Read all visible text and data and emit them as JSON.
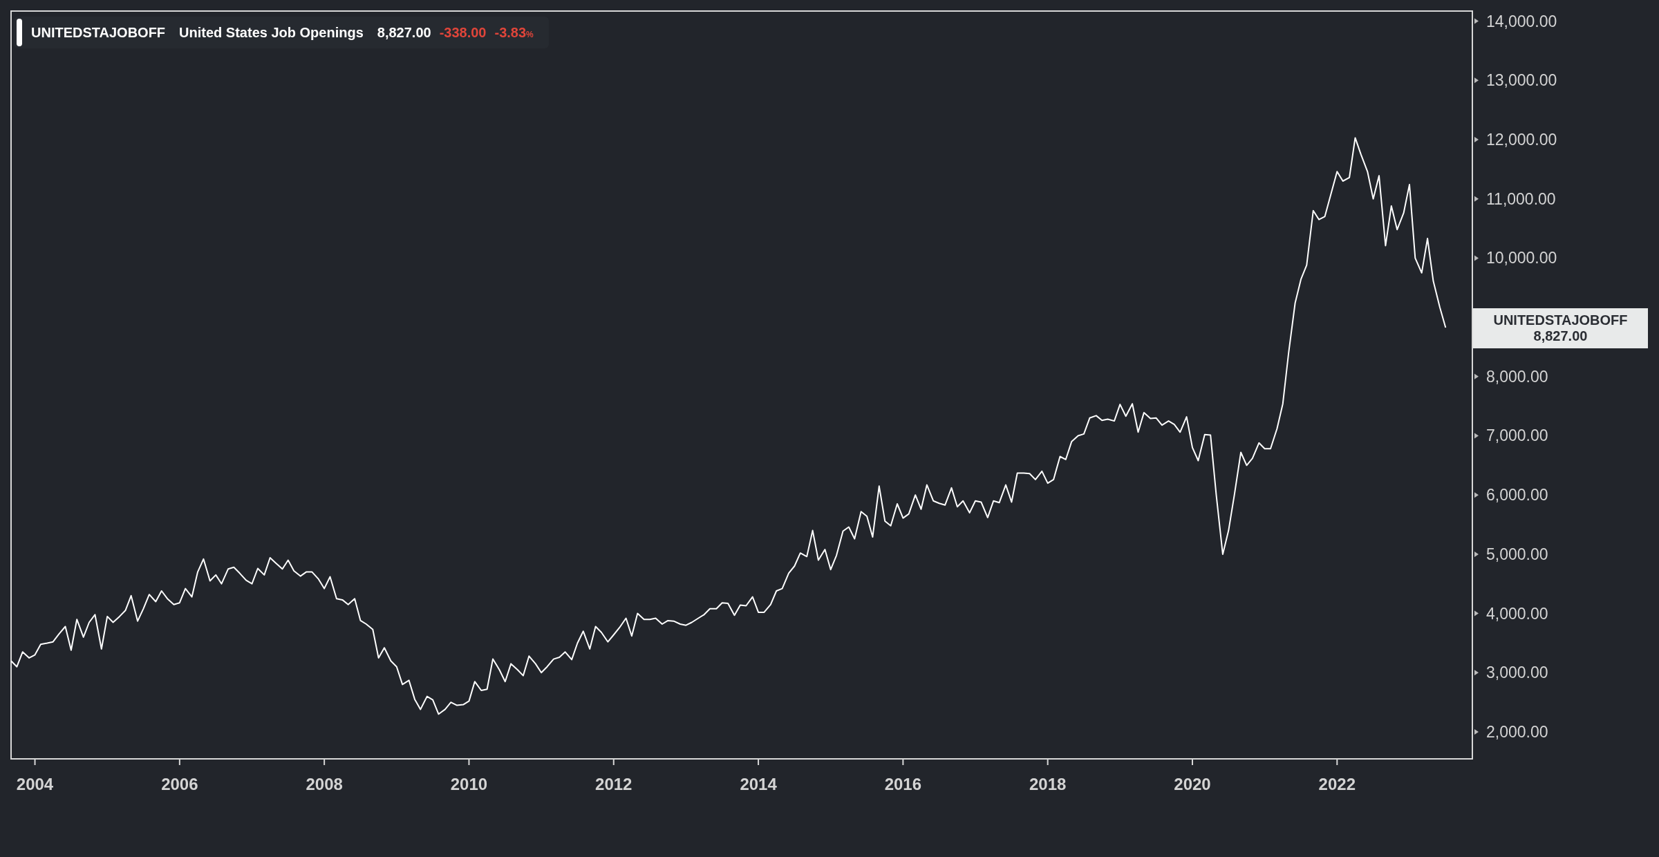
{
  "legend": {
    "symbol": "UNITEDSTAJOBOFF",
    "name": "United States Job Openings",
    "value": "8,827.00",
    "change": "-338.00",
    "change_percent": "-3.83",
    "percent_sign": "%"
  },
  "price_label": {
    "value": "8,827.00"
  },
  "chart_data": {
    "type": "line",
    "xlim": [
      2003.67,
      2023.87
    ],
    "ylim": [
      1545,
      14170
    ],
    "xticks": [
      {
        "value": 2004,
        "label": "2004"
      },
      {
        "value": 2006,
        "label": "2006"
      },
      {
        "value": 2008,
        "label": "2008"
      },
      {
        "value": 2010,
        "label": "2010"
      },
      {
        "value": 2012,
        "label": "2012"
      },
      {
        "value": 2014,
        "label": "2014"
      },
      {
        "value": 2016,
        "label": "2016"
      },
      {
        "value": 2018,
        "label": "2018"
      },
      {
        "value": 2020,
        "label": "2020"
      },
      {
        "value": 2022,
        "label": "2022"
      }
    ],
    "x": [
      2003.67,
      2003.75,
      2003.83,
      2003.92,
      2004,
      2004.08,
      2004.17,
      2004.25,
      2004.33,
      2004.42,
      2004.5,
      2004.58,
      2004.67,
      2004.75,
      2004.83,
      2004.92,
      2005,
      2005.08,
      2005.17,
      2005.25,
      2005.33,
      2005.42,
      2005.5,
      2005.58,
      2005.67,
      2005.75,
      2005.83,
      2005.92,
      2006,
      2006.08,
      2006.17,
      2006.25,
      2006.33,
      2006.42,
      2006.5,
      2006.58,
      2006.67,
      2006.75,
      2006.83,
      2006.92,
      2007,
      2007.08,
      2007.17,
      2007.25,
      2007.33,
      2007.42,
      2007.5,
      2007.58,
      2007.67,
      2007.75,
      2007.83,
      2007.92,
      2008,
      2008.08,
      2008.17,
      2008.25,
      2008.33,
      2008.42,
      2008.5,
      2008.58,
      2008.67,
      2008.75,
      2008.83,
      2008.92,
      2009,
      2009.08,
      2009.17,
      2009.25,
      2009.33,
      2009.42,
      2009.5,
      2009.58,
      2009.67,
      2009.75,
      2009.83,
      2009.92,
      2010,
      2010.08,
      2010.17,
      2010.25,
      2010.33,
      2010.42,
      2010.5,
      2010.58,
      2010.67,
      2010.75,
      2010.83,
      2010.92,
      2011,
      2011.08,
      2011.17,
      2011.25,
      2011.33,
      2011.42,
      2011.5,
      2011.58,
      2011.67,
      2011.75,
      2011.83,
      2011.92,
      2012,
      2012.08,
      2012.17,
      2012.25,
      2012.33,
      2012.42,
      2012.5,
      2012.58,
      2012.67,
      2012.75,
      2012.83,
      2012.92,
      2013,
      2013.08,
      2013.17,
      2013.25,
      2013.33,
      2013.42,
      2013.5,
      2013.58,
      2013.67,
      2013.75,
      2013.83,
      2013.92,
      2014,
      2014.08,
      2014.17,
      2014.25,
      2014.33,
      2014.42,
      2014.5,
      2014.58,
      2014.67,
      2014.75,
      2014.83,
      2014.92,
      2015,
      2015.08,
      2015.17,
      2015.25,
      2015.33,
      2015.42,
      2015.5,
      2015.58,
      2015.67,
      2015.75,
      2015.83,
      2015.92,
      2016,
      2016.08,
      2016.17,
      2016.25,
      2016.33,
      2016.42,
      2016.5,
      2016.58,
      2016.67,
      2016.75,
      2016.83,
      2016.92,
      2017,
      2017.08,
      2017.17,
      2017.25,
      2017.33,
      2017.42,
      2017.5,
      2017.58,
      2017.67,
      2017.75,
      2017.83,
      2017.92,
      2018,
      2018.08,
      2018.17,
      2018.25,
      2018.33,
      2018.42,
      2018.5,
      2018.58,
      2018.67,
      2018.75,
      2018.83,
      2018.92,
      2019,
      2019.08,
      2019.17,
      2019.25,
      2019.33,
      2019.42,
      2019.5,
      2019.58,
      2019.67,
      2019.75,
      2019.83,
      2019.92,
      2020,
      2020.08,
      2020.17,
      2020.25,
      2020.33,
      2020.42,
      2020.5,
      2020.58,
      2020.67,
      2020.75,
      2020.83,
      2020.92,
      2021,
      2021.08,
      2021.17,
      2021.25,
      2021.33,
      2021.42,
      2021.5,
      2021.58,
      2021.67,
      2021.75,
      2021.83,
      2021.92,
      2022,
      2022.08,
      2022.17,
      2022.25,
      2022.33,
      2022.42,
      2022.5,
      2022.58,
      2022.67,
      2022.75,
      2022.83,
      2022.92,
      2023,
      2023.08,
      2023.17,
      2023.25,
      2023.33,
      2023.42,
      2023.5
    ],
    "yticks": [
      {
        "value": 2000,
        "label": "2,000.00"
      },
      {
        "value": 3000,
        "label": "3,000.00"
      },
      {
        "value": 4000,
        "label": "4,000.00"
      },
      {
        "value": 5000,
        "label": "5,000.00"
      },
      {
        "value": 6000,
        "label": "6,000.00"
      },
      {
        "value": 7000,
        "label": "7,000.00"
      },
      {
        "value": 8000,
        "label": "8,000.00"
      },
      {
        "value": 10000,
        "label": "10,000.00"
      },
      {
        "value": 11000,
        "label": "11,000.00"
      },
      {
        "value": 12000,
        "label": "12,000.00"
      },
      {
        "value": 13000,
        "label": "13,000.00"
      },
      {
        "value": 14000,
        "label": "14,000.00"
      }
    ],
    "series": [
      {
        "name": "UNITEDSTAJOBOFF",
        "color": "#ffffff",
        "values": [
          3200,
          3100,
          3350,
          3250,
          3300,
          3480,
          3500,
          3520,
          3650,
          3780,
          3380,
          3900,
          3600,
          3850,
          3980,
          3400,
          3950,
          3850,
          3950,
          4050,
          4300,
          3870,
          4080,
          4320,
          4200,
          4380,
          4250,
          4150,
          4180,
          4420,
          4280,
          4700,
          4920,
          4550,
          4650,
          4500,
          4750,
          4780,
          4680,
          4560,
          4500,
          4760,
          4650,
          4940,
          4850,
          4750,
          4900,
          4720,
          4630,
          4700,
          4700,
          4580,
          4420,
          4620,
          4250,
          4230,
          4150,
          4250,
          3880,
          3820,
          3730,
          3250,
          3420,
          3200,
          3100,
          2800,
          2870,
          2550,
          2380,
          2600,
          2540,
          2300,
          2380,
          2500,
          2450,
          2460,
          2520,
          2850,
          2700,
          2720,
          3230,
          3050,
          2850,
          3150,
          3050,
          2950,
          3280,
          3150,
          3000,
          3100,
          3230,
          3260,
          3350,
          3220,
          3500,
          3700,
          3400,
          3780,
          3680,
          3520,
          3640,
          3760,
          3920,
          3620,
          4000,
          3900,
          3900,
          3920,
          3820,
          3880,
          3870,
          3820,
          3800,
          3850,
          3920,
          3980,
          4080,
          4080,
          4180,
          4170,
          3970,
          4140,
          4130,
          4280,
          4020,
          4020,
          4150,
          4380,
          4420,
          4680,
          4800,
          5020,
          4960,
          5400,
          4900,
          5080,
          4740,
          4980,
          5390,
          5460,
          5260,
          5720,
          5640,
          5290,
          6150,
          5560,
          5480,
          5850,
          5610,
          5680,
          6000,
          5760,
          6170,
          5900,
          5860,
          5830,
          6120,
          5800,
          5900,
          5700,
          5900,
          5880,
          5620,
          5900,
          5870,
          6170,
          5880,
          6370,
          6370,
          6360,
          6260,
          6400,
          6200,
          6260,
          6650,
          6600,
          6900,
          7000,
          7030,
          7300,
          7340,
          7260,
          7280,
          7250,
          7530,
          7330,
          7540,
          7060,
          7390,
          7290,
          7300,
          7180,
          7250,
          7190,
          7060,
          7320,
          6800,
          6580,
          7020,
          7010,
          6000,
          5000,
          5400,
          6000,
          6720,
          6500,
          6620,
          6880,
          6780,
          6780,
          7120,
          7540,
          8400,
          9240,
          9640,
          9880,
          10800,
          10650,
          10700,
          11100,
          11460,
          11300,
          11360,
          12030,
          11750,
          11460,
          11000,
          11390,
          10210,
          10880,
          10480,
          10760,
          11240,
          10000,
          9750,
          10330,
          9610,
          9170,
          8827
        ]
      }
    ]
  }
}
